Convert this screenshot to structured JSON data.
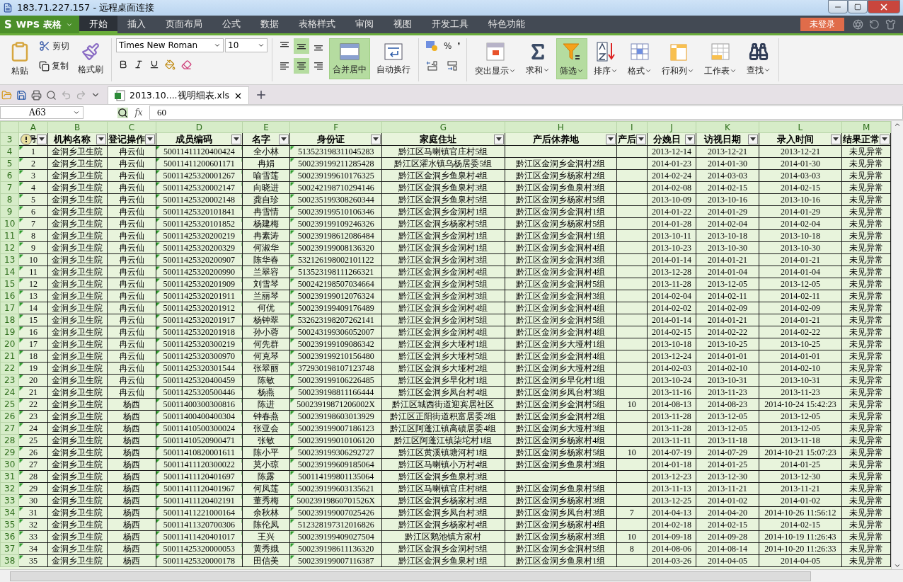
{
  "window": {
    "title": "183.71.227.157 - 远程桌面连接"
  },
  "app_button": {
    "logo": "S",
    "label": "WPS 表格"
  },
  "menu_tabs": [
    {
      "label": "开始",
      "selected": true
    },
    {
      "label": "插入",
      "selected": false
    },
    {
      "label": "页面布局",
      "selected": false
    },
    {
      "label": "公式",
      "selected": false
    },
    {
      "label": "数据",
      "selected": false
    },
    {
      "label": "表格样式",
      "selected": false
    },
    {
      "label": "审阅",
      "selected": false
    },
    {
      "label": "视图",
      "selected": false
    },
    {
      "label": "开发工具",
      "selected": false
    },
    {
      "label": "特色功能",
      "selected": false
    }
  ],
  "login_button": "未登录",
  "ribbon": {
    "clipboard": {
      "paste": "粘贴",
      "cut": "剪切",
      "copy": "复制",
      "format_painter": "格式刷"
    },
    "font": {
      "name": "Times New Roman",
      "size": "10"
    },
    "align_buttons": [
      {
        "kind": "top",
        "selected": false
      },
      {
        "kind": "middle",
        "selected": true
      },
      {
        "kind": "bottom",
        "selected": false
      },
      {
        "kind": "left",
        "selected": false
      },
      {
        "kind": "center",
        "selected": true
      },
      {
        "kind": "right",
        "selected": false
      }
    ],
    "merge": {
      "label": "合并居中",
      "selected": true
    },
    "wrap": "自动换行",
    "number": {
      "percent": "%",
      "comma": "❜"
    },
    "tools": [
      {
        "kind": "highlight",
        "label": "突出显示",
        "selected": false
      },
      {
        "kind": "sum",
        "label": "求和",
        "selected": false
      },
      {
        "kind": "filter",
        "label": "筛选",
        "selected": true
      },
      {
        "kind": "sort",
        "label": "排序",
        "selected": false
      },
      {
        "kind": "format",
        "label": "格式",
        "selected": false
      },
      {
        "kind": "rowcol",
        "label": "行和列",
        "selected": false
      },
      {
        "kind": "sheet",
        "label": "工作表",
        "selected": false
      },
      {
        "kind": "find",
        "label": "查找",
        "selected": false
      }
    ]
  },
  "doc_tab": {
    "label": "2013.10....视明细表.xls"
  },
  "formula_bar": {
    "name_box": "A63",
    "fx": "fx",
    "value": "60"
  },
  "sheet": {
    "columns": [
      "A",
      "B",
      "C",
      "D",
      "E",
      "F",
      "G",
      "H",
      "I",
      "J",
      "K",
      "L",
      "M"
    ],
    "header_row": {
      "number": "3",
      "cells": [
        "号",
        "机构名称",
        "登记操作",
        "成员编码",
        "名字",
        "身份证",
        "家庭住址",
        "产后休养地",
        "产后",
        "分娩日",
        "访视日期",
        "录入时间",
        "结果正常"
      ]
    },
    "rows": [
      {
        "number": "4",
        "cells": [
          "1",
          "金洞乡卫生院",
          "冉云仙",
          "50011411120400424",
          "全小林",
          "513523198311045283",
          "黔江区马喇镇官庄村5组",
          null,
          null,
          "2013-12-14",
          "2013-12-21",
          "2013-12-21",
          "未见异常"
        ]
      },
      {
        "number": "5",
        "cells": [
          "2",
          "金洞乡卫生院",
          "冉云仙",
          "50011411200601171",
          "冉娟",
          "500239199211285428",
          "黔江区濯水镇乌杨居委5组",
          "黔江区金洞乡金洞村2组",
          null,
          "2014-01-23",
          "2014-01-30",
          "2014-01-30",
          "未见异常"
        ]
      },
      {
        "number": "6",
        "cells": [
          "3",
          "金洞乡卫生院",
          "冉云仙",
          "50011425320001267",
          "喻雪莲",
          "500239199610176325",
          "黔江区金洞乡鱼泉村4组",
          "黔江区金洞乡杨家村2组",
          null,
          "2014-02-24",
          "2014-03-03",
          "2014-03-03",
          "未见异常"
        ]
      },
      {
        "number": "7",
        "cells": [
          "4",
          "金洞乡卫生院",
          "冉云仙",
          "50011425320002147",
          "向晓进",
          "500242198710294146",
          "黔江区金洞乡鱼泉村3组",
          "黔江区金洞乡鱼泉村3组",
          null,
          "2014-02-08",
          "2014-02-15",
          "2014-02-15",
          "未见异常"
        ]
      },
      {
        "number": "8",
        "cells": [
          "5",
          "金洞乡卫生院",
          "冉云仙",
          "50011425320002148",
          "龚自珍",
          "500235199308260344",
          "黔江区金洞乡鱼泉村5组",
          "黔江区金洞乡杨家村5组",
          null,
          "2013-10-09",
          "2013-10-16",
          "2013-10-16",
          "未见异常"
        ]
      },
      {
        "number": "9",
        "cells": [
          "6",
          "金洞乡卫生院",
          "冉云仙",
          "50011425320101841",
          "冉雪情",
          "500239199510106346",
          "黔江区金洞乡金洞村1组",
          "黔江区金洞乡金洞村1组",
          null,
          "2014-01-22",
          "2014-01-29",
          "2014-01-29",
          "未见异常"
        ]
      },
      {
        "number": "10",
        "cells": [
          "7",
          "金洞乡卫生院",
          "冉云仙",
          "50011425320101852",
          "杨建梅",
          "500239199109246326",
          "黔江区金洞乡杨家村5组",
          "黔江区金洞乡杨家村5组",
          null,
          "2014-01-28",
          "2014-02-04",
          "2014-02-04",
          "未见异常"
        ]
      },
      {
        "number": "11",
        "cells": [
          "8",
          "金洞乡卫生院",
          "冉云仙",
          "50011425320200219",
          "冉素涛",
          "500239198612086484",
          "黔江区金洞乡金洞村1组",
          "黔江区金洞乡金洞村1组",
          null,
          "2013-10-11",
          "2013-10-18",
          "2013-10-18",
          "未见异常"
        ]
      },
      {
        "number": "12",
        "cells": [
          "9",
          "金洞乡卫生院",
          "冉云仙",
          "50011425320200329",
          "何淑华",
          "500239199008136320",
          "黔江区金洞乡金洞村1组",
          "黔江区金洞乡金洞村4组",
          null,
          "2013-10-23",
          "2013-10-30",
          "2013-10-30",
          "未见异常"
        ]
      },
      {
        "number": "13",
        "cells": [
          "10",
          "金洞乡卫生院",
          "冉云仙",
          "50011425320200907",
          "陈华春",
          "532126198002101122",
          "黔江区金洞乡金洞村3组",
          "黔江区金洞乡金洞村3组",
          null,
          "2014-01-14",
          "2014-01-21",
          "2014-01-21",
          "未见异常"
        ]
      },
      {
        "number": "14",
        "cells": [
          "11",
          "金洞乡卫生院",
          "冉云仙",
          "50011425320200990",
          "兰翠容",
          "513523198111266321",
          "黔江区金洞乡金洞村4组",
          "黔江区金洞乡金洞村4组",
          null,
          "2013-12-28",
          "2014-01-04",
          "2014-01-04",
          "未见异常"
        ]
      },
      {
        "number": "15",
        "cells": [
          "12",
          "金洞乡卫生院",
          "冉云仙",
          "50011425320201909",
          "刘雪琴",
          "500242198507034664",
          "黔江区金洞乡金洞村5组",
          "黔江区金洞乡金洞村5组",
          null,
          "2013-11-28",
          "2013-12-05",
          "2013-12-05",
          "未见异常"
        ]
      },
      {
        "number": "16",
        "cells": [
          "13",
          "金洞乡卫生院",
          "冉云仙",
          "50011425320201911",
          "兰丽琴",
          "500239199012076324",
          "黔江区金洞乡金洞村3组",
          "黔江区金洞乡金洞村3组",
          null,
          "2014-02-04",
          "2014-02-11",
          "2014-02-11",
          "未见异常"
        ]
      },
      {
        "number": "17",
        "cells": [
          "14",
          "金洞乡卫生院",
          "冉云仙",
          "50011425320201912",
          "何优",
          "500239199409176489",
          "黔江区金洞乡金洞村4组",
          "黔江区金洞乡金洞村4组",
          null,
          "2014-02-02",
          "2014-02-09",
          "2014-02-09",
          "未见异常"
        ]
      },
      {
        "number": "18",
        "cells": [
          "15",
          "金洞乡卫生院",
          "冉云仙",
          "50011425320201917",
          "杨钟翠",
          "532623198207262141",
          "黔江区金洞乡金洞村5组",
          "黔江区金洞乡金洞村5组",
          null,
          "2014-01-14",
          "2014-01-21",
          "2014-01-21",
          "未见异常"
        ]
      },
      {
        "number": "19",
        "cells": [
          "16",
          "金洞乡卫生院",
          "冉云仙",
          "50011425320201918",
          "孙小蓉",
          "500243199306052007",
          "黔江区金洞乡金洞村4组",
          "黔江区金洞乡金洞村4组",
          null,
          "2014-02-15",
          "2014-02-22",
          "2014-02-22",
          "未见异常"
        ]
      },
      {
        "number": "20",
        "cells": [
          "17",
          "金洞乡卫生院",
          "冉云仙",
          "50011425320300219",
          "何先群",
          "500239199109086342",
          "黔江区金洞乡大垭村1组",
          "黔江区金洞乡大垭村1组",
          null,
          "2013-10-18",
          "2013-10-25",
          "2013-10-25",
          "未见异常"
        ]
      },
      {
        "number": "21",
        "cells": [
          "18",
          "金洞乡卫生院",
          "冉云仙",
          "50011425320300970",
          "何克琴",
          "500239199210156480",
          "黔江区金洞乡大垭村5组",
          "黔江区金洞乡金洞村4组",
          null,
          "2013-12-24",
          "2014-01-01",
          "2014-01-01",
          "未见异常"
        ]
      },
      {
        "number": "22",
        "cells": [
          "19",
          "金洞乡卫生院",
          "冉云仙",
          "50011425320301544",
          "张翠丽",
          "372930198107123748",
          "黔江区金洞乡大垭村2组",
          "黔江区金洞乡大垭村2组",
          null,
          "2014-02-03",
          "2014-02-10",
          "2014-02-10",
          "未见异常"
        ]
      },
      {
        "number": "23",
        "cells": [
          "20",
          "金洞乡卫生院",
          "冉云仙",
          "50011425320400459",
          "陈敏",
          "500239199106226485",
          "黔江区金洞乡早化村1组",
          "黔江区金洞乡早化村1组",
          null,
          "2013-10-24",
          "2013-10-31",
          "2013-10-31",
          "未见异常"
        ]
      },
      {
        "number": "24",
        "cells": [
          "21",
          "金洞乡卫生院",
          "冉云仙",
          "50011425320500446",
          "杨燕",
          "500239198811166444",
          "黔江区金洞乡凤台村4组",
          "黔江区金洞乡凤台村3组",
          null,
          "2013-11-16",
          "2013-11-23",
          "2013-11-23",
          "未见异常"
        ]
      },
      {
        "number": "25",
        "cells": [
          "22",
          "金洞乡卫生院",
          "杨西",
          "50011400300300816",
          "陈进",
          "50023919871206002X",
          "黔江区城西街道迎宾居社区",
          "黔江区金洞乡金洞村5组",
          "10",
          "2014-08-13",
          "2014-08-23",
          "2014-10-24 15:42:23",
          "未见异常"
        ]
      },
      {
        "number": "26",
        "cells": [
          "23",
          "金洞乡卫生院",
          "杨西",
          "50011400400400304",
          "钟春燕",
          "500239198603013929",
          "黔江区正阳街道积富居委2组",
          "黔江区金洞乡金洞村2组",
          null,
          "2013-11-28",
          "2013-12-05",
          "2013-12-05",
          "未见异常"
        ]
      },
      {
        "number": "27",
        "cells": [
          "24",
          "金洞乡卫生院",
          "杨西",
          "50011410500300024",
          "张亚会",
          "500239199007186123",
          "黔江区阿蓬江镇高碛居委4组",
          "黔江区金洞乡大垭村3组",
          null,
          "2013-11-28",
          "2013-12-05",
          "2013-12-05",
          "未见异常"
        ]
      },
      {
        "number": "28",
        "cells": [
          "25",
          "金洞乡卫生院",
          "杨西",
          "50011410520900471",
          "张敏",
          "500239199010106120",
          "黔江区阿蓬江镇柒坨村1组",
          "黔江区金洞乡杨家村4组",
          null,
          "2013-11-11",
          "2013-11-18",
          "2013-11-18",
          "未见异常"
        ]
      },
      {
        "number": "29",
        "cells": [
          "26",
          "金洞乡卫生院",
          "杨西",
          "50011410820001611",
          "陈小平",
          "500239199306292727",
          "黔江区黄溪镇塘河村1组",
          "黔江区金洞乡杨家村5组",
          "10",
          "2014-07-19",
          "2014-07-29",
          "2014-10-21 15:07:23",
          "未见异常"
        ]
      },
      {
        "number": "30",
        "cells": [
          "27",
          "金洞乡卫生院",
          "杨西",
          "50011411120300022",
          "莫小琼",
          "500239199609185064",
          "黔江区马喇镇小万村4组",
          "黔江区金洞乡鱼泉村3组",
          null,
          "2014-01-18",
          "2014-01-25",
          "2014-01-25",
          "未见异常"
        ]
      },
      {
        "number": "31",
        "cells": [
          "28",
          "金洞乡卫生院",
          "杨西",
          "50011411120401697",
          "陈露",
          "500114199801135064",
          "黔江区金洞乡鱼泉村3组",
          null,
          null,
          "2013-12-23",
          "2013-12-30",
          "2013-12-30",
          "未见异常"
        ]
      },
      {
        "number": "32",
        "cells": [
          "29",
          "金洞乡卫生院",
          "杨西",
          "50011411120401967",
          "何凤莲",
          "500239199603135621",
          "黔江区马喇镇官庄村8组",
          "黔江区金洞乡鱼泉村5组",
          null,
          "2013-11-13",
          "2013-11-21",
          "2013-11-21",
          "未见异常"
        ]
      },
      {
        "number": "33",
        "cells": [
          "30",
          "金洞乡卫生院",
          "杨西",
          "50011411120402191",
          "董秀梅",
          "50023919860701526X",
          "黔江区金洞乡杨家村3组",
          "黔江区金洞乡杨家村3组",
          null,
          "2013-12-25",
          "2014-01-02",
          "2014-01-02",
          "未见异常"
        ]
      },
      {
        "number": "34",
        "cells": [
          "31",
          "金洞乡卫生院",
          "杨西",
          "50011411221000164",
          "余秋林",
          "500239199007025426",
          "黔江区金洞乡凤台村3组",
          "黔江区金洞乡凤台村3组",
          "7",
          "2014-04-13",
          "2014-04-20",
          "2014-10-26 11:56:12",
          "未见异常"
        ]
      },
      {
        "number": "35",
        "cells": [
          "32",
          "金洞乡卫生院",
          "杨西",
          "50011411320700306",
          "陈伦凤",
          "512328197312016826",
          "黔江区金洞乡杨家村4组",
          "黔江区金洞乡杨家村4组",
          null,
          "2014-02-18",
          "2014-02-15",
          "2014-02-15",
          "未见异常"
        ]
      },
      {
        "number": "36",
        "cells": [
          "33",
          "金洞乡卫生院",
          "杨西",
          "50011411420401017",
          "王兴",
          "500239199409027504",
          "黔江区鹅池镇方家村",
          "黔江区金洞乡杨家村3组",
          "10",
          "2014-09-18",
          "2014-09-28",
          "2014-10-19 11:26:43",
          "未见异常"
        ]
      },
      {
        "number": "37",
        "cells": [
          "34",
          "金洞乡卫生院",
          "杨西",
          "50011425320000053",
          "黄秀娥",
          "500239198611136320",
          "黔江区金洞乡金洞村5组",
          "黔江区金洞乡金洞村5组",
          "8",
          "2014-08-06",
          "2014-08-14",
          "2014-10-20 11:26:33",
          "未见异常"
        ]
      },
      {
        "number": "38",
        "cells": [
          "35",
          "金洞乡卫生院",
          "杨西",
          "50011425320000178",
          "田信美",
          "500239199007116387",
          "黔江区金洞乡鱼泉村1组",
          "黔江区金洞乡鱼泉村1组",
          null,
          "2014-03-26",
          "2014-04-05",
          "2014-04-05",
          "未见异常"
        ]
      }
    ]
  }
}
